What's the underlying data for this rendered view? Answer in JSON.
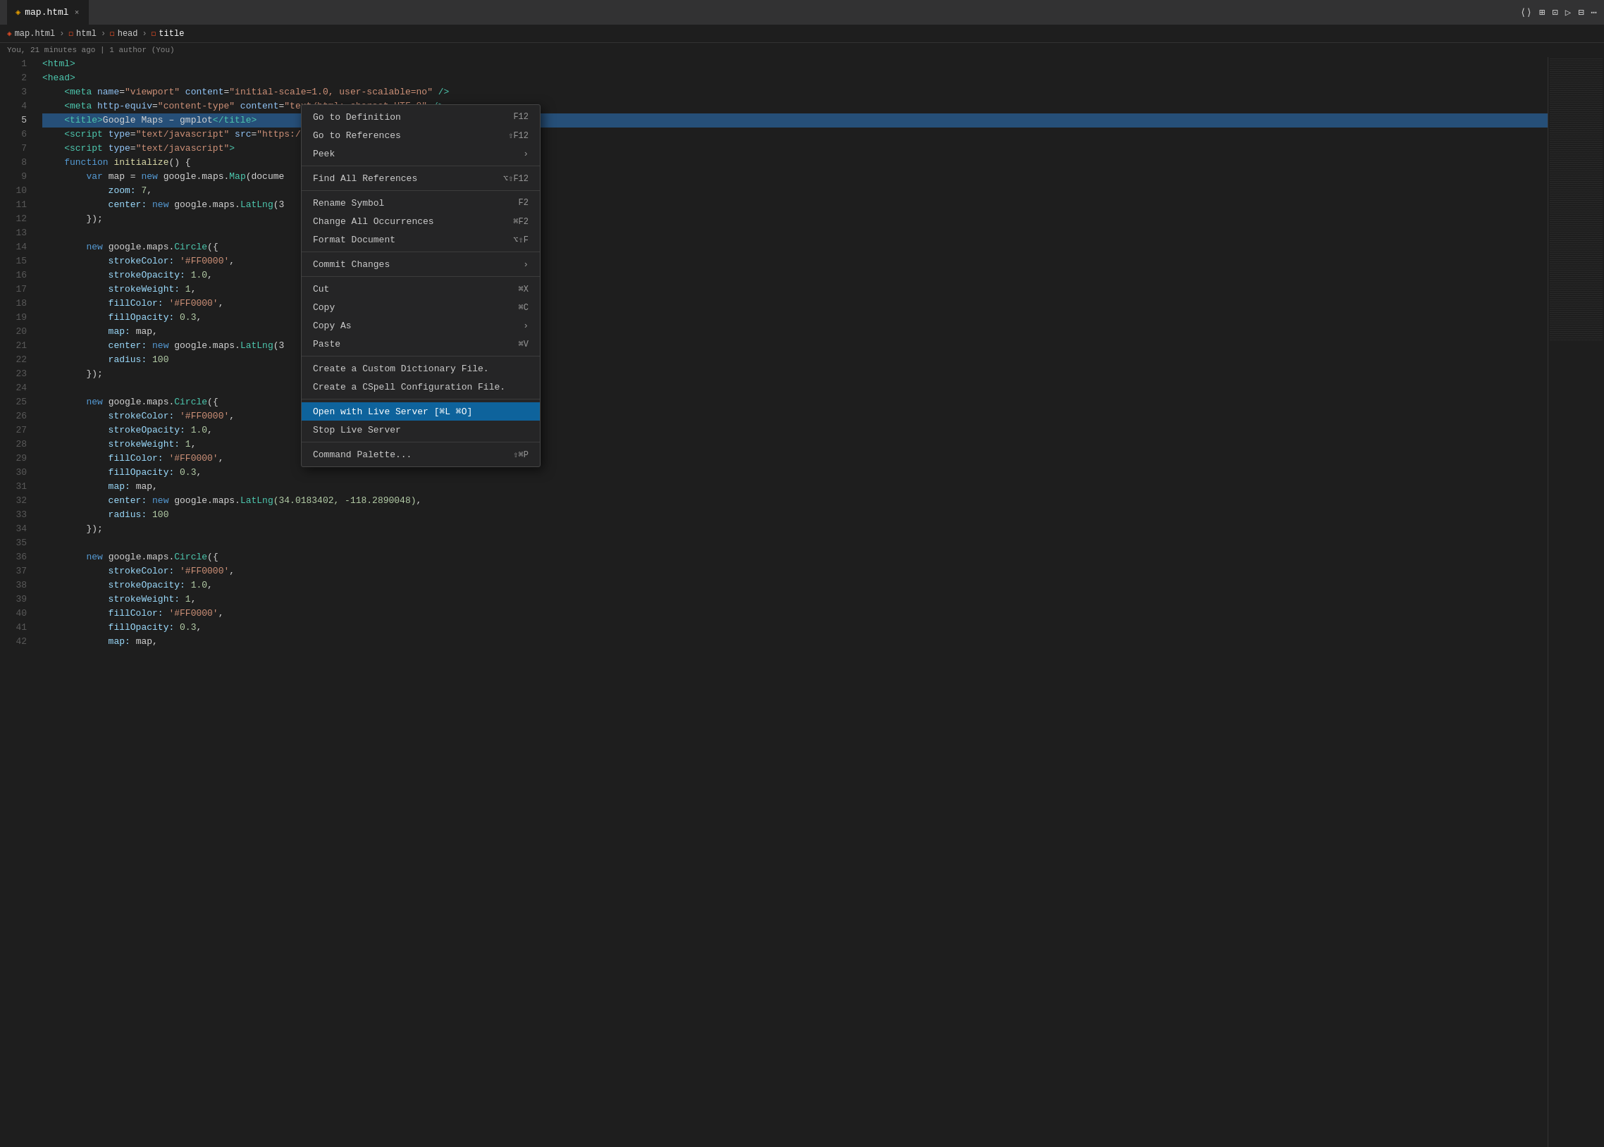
{
  "titleBar": {
    "tab": {
      "icon": "◈",
      "label": "map.html",
      "close": "×"
    },
    "controls": [
      "⟨⟩",
      "⊞",
      "⊡",
      "▷",
      "⊟",
      "⋯"
    ]
  },
  "breadcrumb": {
    "items": [
      {
        "icon": "◈",
        "iconClass": "html",
        "label": "map.html"
      },
      {
        "icon": "◻",
        "iconClass": "html",
        "label": "html"
      },
      {
        "icon": "◻",
        "iconClass": "html",
        "label": "head"
      },
      {
        "icon": "◻",
        "iconClass": "html",
        "label": "title"
      }
    ]
  },
  "blame": {
    "text": "You, 21 minutes ago | 1 author (You)"
  },
  "codeLines": [
    {
      "num": 1,
      "tokens": [
        {
          "t": "<html>",
          "c": "tag"
        }
      ]
    },
    {
      "num": 2,
      "tokens": [
        {
          "t": "<head>",
          "c": "tag"
        }
      ]
    },
    {
      "num": 3,
      "tokens": [
        {
          "t": "    <meta ",
          "c": "tag"
        },
        {
          "t": "name",
          "c": "attrname"
        },
        {
          "t": "=",
          "c": "plain"
        },
        {
          "t": "\"viewport\"",
          "c": "str"
        },
        {
          "t": " content",
          "c": "attrname"
        },
        {
          "t": "=",
          "c": "plain"
        },
        {
          "t": "\"initial-scale=1.0, user-scalable=no\"",
          "c": "str"
        },
        {
          "t": " />",
          "c": "tag"
        }
      ]
    },
    {
      "num": 4,
      "tokens": [
        {
          "t": "    <meta ",
          "c": "tag"
        },
        {
          "t": "http-equiv",
          "c": "attrname"
        },
        {
          "t": "=",
          "c": "plain"
        },
        {
          "t": "\"content-type\"",
          "c": "str"
        },
        {
          "t": " content",
          "c": "attrname"
        },
        {
          "t": "=",
          "c": "plain"
        },
        {
          "t": "\"text/html; charset=UTF-8\"",
          "c": "str"
        },
        {
          "t": " />",
          "c": "tag"
        }
      ]
    },
    {
      "num": 5,
      "tokens": [
        {
          "t": "    <title>",
          "c": "tag"
        },
        {
          "t": "Google Maps – gmplot",
          "c": "plain"
        },
        {
          "t": "</title>",
          "c": "tag"
        }
      ],
      "highlight": true
    },
    {
      "num": 6,
      "tokens": [
        {
          "t": "    <script ",
          "c": "tag"
        },
        {
          "t": "type",
          "c": "attrname"
        },
        {
          "t": "=",
          "c": "plain"
        },
        {
          "t": "\"text/javascript\"",
          "c": "str"
        },
        {
          "t": " src",
          "c": "attrname"
        },
        {
          "t": "=",
          "c": "plain"
        },
        {
          "t": "\"https://",
          "c": "str"
        }
      ]
    },
    {
      "num": 7,
      "tokens": [
        {
          "t": "    <script ",
          "c": "tag"
        },
        {
          "t": "type",
          "c": "attrname"
        },
        {
          "t": "=",
          "c": "plain"
        },
        {
          "t": "\"text/javascript\"",
          "c": "str"
        },
        {
          "t": ">",
          "c": "tag"
        }
      ]
    },
    {
      "num": 8,
      "tokens": [
        {
          "t": "    ",
          "c": "plain"
        },
        {
          "t": "function ",
          "c": "kw"
        },
        {
          "t": "initialize",
          "c": "fn"
        },
        {
          "t": "() {",
          "c": "plain"
        }
      ]
    },
    {
      "num": 9,
      "tokens": [
        {
          "t": "        ",
          "c": "plain"
        },
        {
          "t": "var ",
          "c": "kw"
        },
        {
          "t": "map = ",
          "c": "plain"
        },
        {
          "t": "new ",
          "c": "kw"
        },
        {
          "t": "google.maps.",
          "c": "plain"
        },
        {
          "t": "Map",
          "c": "type"
        },
        {
          "t": "(docume",
          "c": "plain"
        }
      ]
    },
    {
      "num": 10,
      "tokens": [
        {
          "t": "            zoom: ",
          "c": "prop"
        },
        {
          "t": "7",
          "c": "num"
        },
        {
          "t": ",",
          "c": "plain"
        }
      ]
    },
    {
      "num": 11,
      "tokens": [
        {
          "t": "            center: ",
          "c": "prop"
        },
        {
          "t": "new ",
          "c": "kw"
        },
        {
          "t": "google.maps.",
          "c": "plain"
        },
        {
          "t": "LatLng",
          "c": "type"
        },
        {
          "t": "(3",
          "c": "plain"
        }
      ]
    },
    {
      "num": 12,
      "tokens": [
        {
          "t": "        });",
          "c": "plain"
        }
      ]
    },
    {
      "num": 13,
      "tokens": []
    },
    {
      "num": 14,
      "tokens": [
        {
          "t": "        ",
          "c": "plain"
        },
        {
          "t": "new ",
          "c": "kw"
        },
        {
          "t": "google.maps.",
          "c": "plain"
        },
        {
          "t": "Circle",
          "c": "type"
        },
        {
          "t": "({",
          "c": "plain"
        }
      ]
    },
    {
      "num": 15,
      "tokens": [
        {
          "t": "            strokeColor: ",
          "c": "prop"
        },
        {
          "t": "'#FF0000'",
          "c": "str"
        },
        {
          "t": ",",
          "c": "plain"
        }
      ]
    },
    {
      "num": 16,
      "tokens": [
        {
          "t": "            strokeOpacity: ",
          "c": "prop"
        },
        {
          "t": "1.0",
          "c": "num"
        },
        {
          "t": ",",
          "c": "plain"
        }
      ]
    },
    {
      "num": 17,
      "tokens": [
        {
          "t": "            strokeWeight: ",
          "c": "prop"
        },
        {
          "t": "1",
          "c": "num"
        },
        {
          "t": ",",
          "c": "plain"
        }
      ]
    },
    {
      "num": 18,
      "tokens": [
        {
          "t": "            fillColor: ",
          "c": "prop"
        },
        {
          "t": "'#FF0000'",
          "c": "str"
        },
        {
          "t": ",",
          "c": "plain"
        }
      ]
    },
    {
      "num": 19,
      "tokens": [
        {
          "t": "            fillOpacity: ",
          "c": "prop"
        },
        {
          "t": "0.3",
          "c": "num"
        },
        {
          "t": ",",
          "c": "plain"
        }
      ]
    },
    {
      "num": 20,
      "tokens": [
        {
          "t": "            map: ",
          "c": "prop"
        },
        {
          "t": "map,",
          "c": "plain"
        }
      ]
    },
    {
      "num": 21,
      "tokens": [
        {
          "t": "            center: ",
          "c": "prop"
        },
        {
          "t": "new ",
          "c": "kw"
        },
        {
          "t": "google.maps.",
          "c": "plain"
        },
        {
          "t": "LatLng",
          "c": "type"
        },
        {
          "t": "(3",
          "c": "plain"
        }
      ]
    },
    {
      "num": 22,
      "tokens": [
        {
          "t": "            radius: ",
          "c": "prop"
        },
        {
          "t": "100",
          "c": "num"
        }
      ]
    },
    {
      "num": 23,
      "tokens": [
        {
          "t": "        });",
          "c": "plain"
        }
      ]
    },
    {
      "num": 24,
      "tokens": []
    },
    {
      "num": 25,
      "tokens": [
        {
          "t": "        ",
          "c": "plain"
        },
        {
          "t": "new ",
          "c": "kw"
        },
        {
          "t": "google.maps.",
          "c": "plain"
        },
        {
          "t": "Circle",
          "c": "type"
        },
        {
          "t": "({",
          "c": "plain"
        }
      ]
    },
    {
      "num": 26,
      "tokens": [
        {
          "t": "            strokeColor: ",
          "c": "prop"
        },
        {
          "t": "'#FF0000'",
          "c": "str"
        },
        {
          "t": ",",
          "c": "plain"
        }
      ]
    },
    {
      "num": 27,
      "tokens": [
        {
          "t": "            strokeOpacity: ",
          "c": "prop"
        },
        {
          "t": "1.0",
          "c": "num"
        },
        {
          "t": ",",
          "c": "plain"
        }
      ]
    },
    {
      "num": 28,
      "tokens": [
        {
          "t": "            strokeWeight: ",
          "c": "prop"
        },
        {
          "t": "1",
          "c": "num"
        },
        {
          "t": ",",
          "c": "plain"
        }
      ]
    },
    {
      "num": 29,
      "tokens": [
        {
          "t": "            fillColor: ",
          "c": "prop"
        },
        {
          "t": "'#FF0000'",
          "c": "str"
        },
        {
          "t": ",",
          "c": "plain"
        }
      ]
    },
    {
      "num": 30,
      "tokens": [
        {
          "t": "            fillOpacity: ",
          "c": "prop"
        },
        {
          "t": "0.3",
          "c": "num"
        },
        {
          "t": ",",
          "c": "plain"
        }
      ]
    },
    {
      "num": 31,
      "tokens": [
        {
          "t": "            map: ",
          "c": "prop"
        },
        {
          "t": "map,",
          "c": "plain"
        }
      ]
    },
    {
      "num": 32,
      "tokens": [
        {
          "t": "            center: ",
          "c": "prop"
        },
        {
          "t": "new ",
          "c": "kw"
        },
        {
          "t": "google.maps.",
          "c": "plain"
        },
        {
          "t": "LatLng",
          "c": "type"
        },
        {
          "t": "(34.0183402, -118.2890048)",
          "c": "num"
        },
        {
          "t": ",",
          "c": "plain"
        }
      ]
    },
    {
      "num": 33,
      "tokens": [
        {
          "t": "            radius: ",
          "c": "prop"
        },
        {
          "t": "100",
          "c": "num"
        }
      ]
    },
    {
      "num": 34,
      "tokens": [
        {
          "t": "        });",
          "c": "plain"
        }
      ]
    },
    {
      "num": 35,
      "tokens": []
    },
    {
      "num": 36,
      "tokens": [
        {
          "t": "        ",
          "c": "plain"
        },
        {
          "t": "new ",
          "c": "kw"
        },
        {
          "t": "google.maps.",
          "c": "plain"
        },
        {
          "t": "Circle",
          "c": "type"
        },
        {
          "t": "({",
          "c": "plain"
        }
      ]
    },
    {
      "num": 37,
      "tokens": [
        {
          "t": "            strokeColor: ",
          "c": "prop"
        },
        {
          "t": "'#FF0000'",
          "c": "str"
        },
        {
          "t": ",",
          "c": "plain"
        }
      ]
    },
    {
      "num": 38,
      "tokens": [
        {
          "t": "            strokeOpacity: ",
          "c": "prop"
        },
        {
          "t": "1.0",
          "c": "num"
        },
        {
          "t": ",",
          "c": "plain"
        }
      ]
    },
    {
      "num": 39,
      "tokens": [
        {
          "t": "            strokeWeight: ",
          "c": "prop"
        },
        {
          "t": "1",
          "c": "num"
        },
        {
          "t": ",",
          "c": "plain"
        }
      ]
    },
    {
      "num": 40,
      "tokens": [
        {
          "t": "            fillColor: ",
          "c": "prop"
        },
        {
          "t": "'#FF0000'",
          "c": "str"
        },
        {
          "t": ",",
          "c": "plain"
        }
      ]
    },
    {
      "num": 41,
      "tokens": [
        {
          "t": "            fillOpacity: ",
          "c": "prop"
        },
        {
          "t": "0.3",
          "c": "num"
        },
        {
          "t": ",",
          "c": "plain"
        }
      ]
    },
    {
      "num": 42,
      "tokens": [
        {
          "t": "            map: ",
          "c": "prop"
        },
        {
          "t": "map,",
          "c": "plain"
        }
      ]
    }
  ],
  "contextMenu": {
    "items": [
      {
        "label": "Go to Definition",
        "shortcut": "F12",
        "arrow": false,
        "separator": false,
        "highlighted": false
      },
      {
        "label": "Go to References",
        "shortcut": "⇧F12",
        "arrow": false,
        "separator": false,
        "highlighted": false
      },
      {
        "label": "Peek",
        "shortcut": "",
        "arrow": true,
        "separator": false,
        "highlighted": false
      },
      {
        "label": "",
        "separator": true
      },
      {
        "label": "Find All References",
        "shortcut": "⌥⇧F12",
        "arrow": false,
        "separator": false,
        "highlighted": false
      },
      {
        "label": "",
        "separator": true
      },
      {
        "label": "Rename Symbol",
        "shortcut": "F2",
        "arrow": false,
        "separator": false,
        "highlighted": false
      },
      {
        "label": "Change All Occurrences",
        "shortcut": "⌘F2",
        "arrow": false,
        "separator": false,
        "highlighted": false
      },
      {
        "label": "Format Document",
        "shortcut": "⌥⇧F",
        "arrow": false,
        "separator": false,
        "highlighted": false
      },
      {
        "label": "",
        "separator": true
      },
      {
        "label": "Commit Changes",
        "shortcut": "",
        "arrow": true,
        "separator": false,
        "highlighted": false
      },
      {
        "label": "",
        "separator": true
      },
      {
        "label": "Cut",
        "shortcut": "⌘X",
        "arrow": false,
        "separator": false,
        "highlighted": false
      },
      {
        "label": "Copy",
        "shortcut": "⌘C",
        "arrow": false,
        "separator": false,
        "highlighted": false
      },
      {
        "label": "Copy As",
        "shortcut": "",
        "arrow": true,
        "separator": false,
        "highlighted": false
      },
      {
        "label": "Paste",
        "shortcut": "⌘V",
        "arrow": false,
        "separator": false,
        "highlighted": false
      },
      {
        "label": "",
        "separator": true
      },
      {
        "label": "Create a Custom Dictionary File.",
        "shortcut": "",
        "arrow": false,
        "separator": false,
        "highlighted": false
      },
      {
        "label": "Create a CSpell Configuration File.",
        "shortcut": "",
        "arrow": false,
        "separator": false,
        "highlighted": false
      },
      {
        "label": "",
        "separator": true
      },
      {
        "label": "Open with Live Server [⌘L ⌘O]",
        "shortcut": "",
        "arrow": false,
        "separator": false,
        "highlighted": true
      },
      {
        "label": "Stop Live Server",
        "shortcut": "",
        "arrow": false,
        "separator": false,
        "highlighted": false
      },
      {
        "label": "",
        "separator": true
      },
      {
        "label": "Command Palette...",
        "shortcut": "⇧⌘P",
        "arrow": false,
        "separator": false,
        "highlighted": false
      }
    ]
  }
}
